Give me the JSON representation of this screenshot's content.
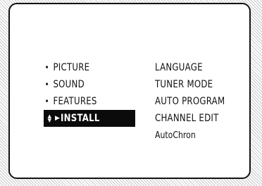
{
  "osd": {
    "main_menu": [
      {
        "label": "PICTURE",
        "selected": false
      },
      {
        "label": "SOUND",
        "selected": false
      },
      {
        "label": "FEATURES",
        "selected": false
      },
      {
        "label": "INSTALL",
        "selected": true
      }
    ],
    "submenu": [
      {
        "label": "LANGUAGE"
      },
      {
        "label": "TUNER MODE"
      },
      {
        "label": "AUTO PROGRAM"
      },
      {
        "label": "CHANNEL EDIT"
      },
      {
        "label": "AutoChron"
      }
    ],
    "bullet_glyph": "•",
    "selection_icon": "up-down-right-arrow-icon"
  }
}
